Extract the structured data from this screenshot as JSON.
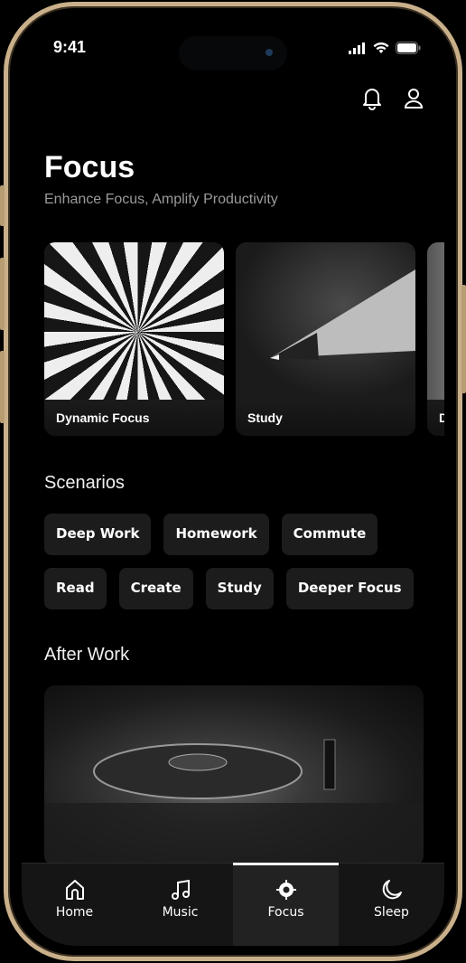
{
  "status_bar": {
    "time": "9:41"
  },
  "header": {
    "title": "Focus",
    "subtitle": "Enhance Focus, Amplify Productivity"
  },
  "cards": [
    {
      "label": "Dynamic Focus",
      "image": "dartboard"
    },
    {
      "label": "Study",
      "image": "pencil-tip"
    },
    {
      "label": "D",
      "image": "partial"
    }
  ],
  "scenarios": {
    "heading": "Scenarios",
    "chips": [
      "Deep Work",
      "Homework",
      "Commute",
      "Read",
      "Create",
      "Study",
      "Deeper Focus"
    ]
  },
  "after_work": {
    "heading": "After Work",
    "image": "turntable"
  },
  "nav": {
    "active": "Focus",
    "tabs": [
      {
        "label": "Home",
        "icon": "home-icon"
      },
      {
        "label": "Music",
        "icon": "music-icon"
      },
      {
        "label": "Focus",
        "icon": "focus-icon"
      },
      {
        "label": "Sleep",
        "icon": "moon-icon"
      }
    ]
  }
}
